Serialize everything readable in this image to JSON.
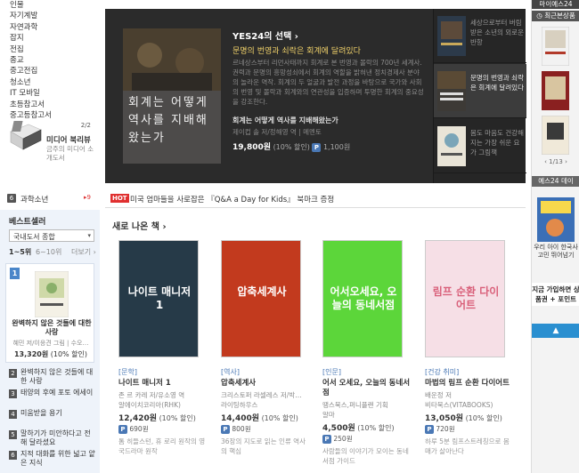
{
  "left_nav": {
    "categories": [
      "인물",
      "자기계발",
      "자연과학",
      "잡지",
      "전집",
      "종교",
      "중고전집",
      "청소년",
      "IT 모바일",
      "초등참고서",
      "중고등참고서"
    ],
    "promo": {
      "count": "2/2",
      "title": "미디어 북리뷰",
      "subtitle": "금주의 미디어 소개도서"
    }
  },
  "hero": {
    "pick_label": "YES24의 선택 ›",
    "headline": "문명의 번영과 쇠락은 회계에 달려있다",
    "description": "르네상스부터 리먼사태까지 회계로 본 번영과 몰락의 700년 세계사. 권력과 문명의 흥망성쇠에서 회계의 역할을 밝혀낸 정치경제사 분야의 놀라운 역작. 회계의 두 얼굴과 발전 과정을 바탕으로 국가와 사회의 번영 및 몰락과 회계와의 연관성을 입증하며 투명한 회계의 중요성을 강조한다.",
    "cover_title": "회계는 어떻게 역사를 지배해왔는가",
    "book_title": "회계는 어떻게 역사를 지배해왔는가",
    "author": "제이컵 솔 저/정해영 역 | 메멘토",
    "price": "19,800원",
    "discount": "(10% 할인)",
    "points_badge": "P",
    "points": "1,100원",
    "side_items": [
      {
        "text": "세상으로부터 버림받은 소년의 외로운 반항"
      },
      {
        "text": "문명의 번영과 쇠락은 회계에 달려있다"
      },
      {
        "text": "몸도 마음도 건강해지는 가장 쉬운 요가 그림책"
      }
    ]
  },
  "right_rail": {
    "top_tab": "마이예스24",
    "recent_title": "최근본상품",
    "pager": "1/13",
    "yes24_title": "예스24 데이",
    "banner_text": "우리 아이 한국사 고민 뛰어넘기",
    "join_text": "지금 가입하면 상품권 + 포인트",
    "up_arrow": "▲"
  },
  "tab_bar": {
    "section_label": "과학소년",
    "section_num": "6",
    "count_badge": "9",
    "hot_label": "HOT",
    "notice": "미국 엄마들을 사로잡은 『Q&A a Day for Kids』 북마크 증정"
  },
  "bestseller": {
    "title": "베스트셀러",
    "select": "국내도서 종합",
    "tab_active": "1~5위",
    "tab_other": "6~10위",
    "more": "더보기 ›",
    "featured": {
      "rank": "1",
      "title": "완벽하지 않은 것들에 대한 사랑",
      "author": "혜민 저/이응견 그림 | 수오…",
      "price": "13,320원",
      "discount": "(10% 할인)"
    },
    "items": [
      {
        "rank": "2",
        "title": "완벽하지 않은 것들에 대한 사랑"
      },
      {
        "rank": "3",
        "title": "태양의 후예 포토 에세이"
      },
      {
        "rank": "4",
        "title": "미움받을 용기"
      },
      {
        "rank": "5",
        "title": "말하기가 미안하다고 전해 달라셨요"
      },
      {
        "rank": "6",
        "title": "지적 대화를 위한 넓고 얕은 지식"
      }
    ]
  },
  "new_books": {
    "title": "새로 나온 책 ›",
    "books": [
      {
        "category": "[문학]",
        "title": "나이트 매니저 1",
        "author": "존 르 카레 저/유소영 역",
        "publisher": "알에이치코리아(RHK)",
        "price": "12,420원",
        "discount": "(10% 할인)",
        "points": "690원",
        "desc": "톰 히들스턴, 휴 로리 원작의 영국드라마 원작",
        "cover_text": "나이트 매니저 1",
        "cover_color": "#263a48"
      },
      {
        "category": "[역사]",
        "title": "압축세계사",
        "author": "크리스토퍼 라셀레스 저/박…",
        "publisher": "라이팅하우스",
        "price": "14,400원",
        "discount": "(10% 할인)",
        "points": "800원",
        "desc": "36장의 지도로 읽는 인류 역사의 핵심",
        "cover_text": "압축세계사",
        "cover_color": "#c23a1e"
      },
      {
        "category": "[인문]",
        "title": "어서 오세요, 오늘의 동네서점",
        "author": "땡스북스,퍼니플랜 기획",
        "publisher": "알마",
        "price": "4,500원",
        "discount": "(10% 할인)",
        "points": "250원",
        "desc": "사람들의 이야기가 모이는 동네서점 가이드",
        "cover_text": "어서오세요, 오늘의 동네서점",
        "cover_color": "#5cd63a"
      },
      {
        "category": "[건강 취미]",
        "title": "마법의 림프 순환 다이어트",
        "author": "배운정 저",
        "publisher": "비타북스(VITABOOKS)",
        "price": "13,050원",
        "discount": "(10% 할인)",
        "points": "720원",
        "desc": "하루 5분 림프스트레칭으로 몸매가 살아난다",
        "cover_text": "림프 순환 다이어트",
        "cover_color": "#f6dfe6"
      }
    ]
  }
}
